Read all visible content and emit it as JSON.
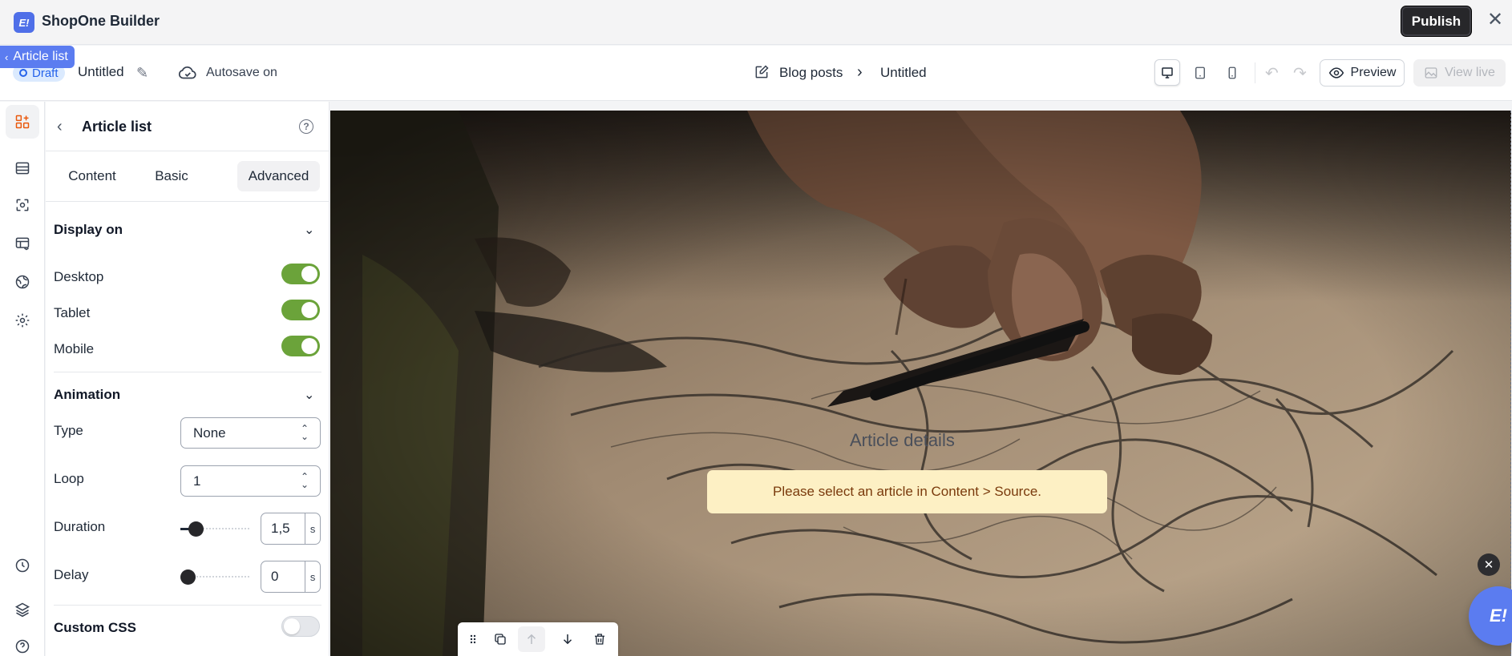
{
  "app": {
    "title": "ShopOne Builder",
    "logo_text": "E!"
  },
  "topbar": {
    "publish_label": "Publish",
    "close_symbol": "✕"
  },
  "selection_chip": {
    "label": "Article list"
  },
  "document": {
    "status": "Draft",
    "title": "Untitled",
    "autosave": "Autosave on"
  },
  "breadcrumb": {
    "items": [
      "Blog posts",
      "Untitled"
    ]
  },
  "toolbar_right": {
    "preview_label": "Preview",
    "view_live_label": "View live"
  },
  "panel": {
    "title": "Article list",
    "tabs": [
      "Content",
      "Basic",
      "Advanced"
    ],
    "active_tab": "Advanced",
    "display_on": {
      "title": "Display on",
      "items": [
        {
          "label": "Desktop",
          "enabled": true
        },
        {
          "label": "Tablet",
          "enabled": true
        },
        {
          "label": "Mobile",
          "enabled": true
        }
      ]
    },
    "animation": {
      "title": "Animation",
      "type_label": "Type",
      "type_value": "None",
      "loop_label": "Loop",
      "loop_value": "1",
      "duration_label": "Duration",
      "duration_value": "1,5",
      "duration_unit": "s",
      "delay_label": "Delay",
      "delay_value": "0",
      "delay_unit": "s"
    },
    "custom_css": {
      "label": "Custom CSS",
      "enabled": false
    }
  },
  "canvas": {
    "heading": "Article details",
    "notice": "Please select an article in Content > Source."
  },
  "colors": {
    "brand": "#5b7cf0",
    "toggle_on": "#6ba33a",
    "notice_bg": "#fdf0c4",
    "notice_text": "#7a3a0c",
    "active_rail_icon": "#ea580c"
  }
}
